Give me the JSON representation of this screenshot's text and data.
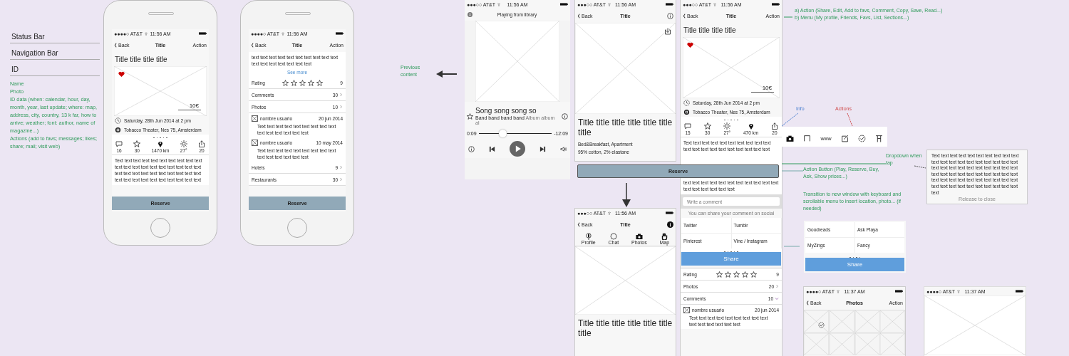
{
  "legend": {
    "rows": [
      "Status Bar",
      "Navigation Bar",
      "ID"
    ],
    "notes": [
      "Name",
      "Photo",
      "ID data (when: calendar, hour, day, month, year, last update; where: map, address, city, country, 13 k far, how to arrive; weather; font: author, name of magazine...)",
      "Actions (add to favs; messages; likes; share; mail; visit web)"
    ]
  },
  "screens": [
    {
      "kind": "phone",
      "status": {
        "carrier": "●●●●○ AT&T",
        "time": "11:56 AM"
      },
      "nav": {
        "back": "Back",
        "title": "Title",
        "right": {
          "kind": "text",
          "label": "Action"
        }
      },
      "overlay_button": {
        "label": "Reserve"
      },
      "blocks": [
        {
          "kind": "title",
          "text": "Title title title title"
        },
        {
          "kind": "photo",
          "favorite": true,
          "price": "10€"
        },
        {
          "kind": "date_info",
          "text": "Saturday, 28th Jun 2014 at 2 pm"
        },
        {
          "kind": "place_info",
          "text": "Tobacco Theater, Nes 75, Amsterdam"
        },
        {
          "kind": "dots"
        },
        {
          "kind": "stats",
          "items": [
            {
              "kind": "comment",
              "value": "16"
            },
            {
              "kind": "star",
              "value": "30"
            },
            {
              "kind": "pin",
              "value": "1470 km"
            },
            {
              "kind": "sun",
              "value": "27°"
            },
            {
              "kind": "share",
              "value": "20"
            }
          ]
        },
        {
          "kind": "text",
          "text": "Text text text text text text text text text text text text text text text text text text text text text text text text text text text text text text text text text text text text text text text text"
        }
      ]
    },
    {
      "kind": "phone",
      "status": {
        "carrier": "●●●●○ AT&T",
        "time": "11:56 AM"
      },
      "nav": {
        "back": "Back",
        "title": "Title",
        "right": {
          "kind": "text",
          "label": "Action"
        }
      },
      "overlay_button": {
        "label": "Reserve"
      },
      "blocks": [
        {
          "kind": "text",
          "text": "text text text text text text text text text text text text text text text text text"
        },
        {
          "kind": "link",
          "text": "See more"
        },
        {
          "kind": "rating",
          "label": "Rating",
          "stars": 0,
          "value": "9"
        },
        {
          "kind": "row",
          "label": "Comments",
          "value": "30",
          "expanded": false
        },
        {
          "kind": "row",
          "label": "Photos",
          "value": "10",
          "expanded": false
        },
        {
          "kind": "comment",
          "user": "nombre usuario",
          "date": "20 jun 2014",
          "text": "Text text text text text text text text text text text text text text text"
        },
        {
          "kind": "comment",
          "user": "nombre usuario",
          "date": "10 may 2014",
          "text": "Text text text text text text text text text text text text text text text"
        },
        {
          "kind": "row",
          "label": "Hotels",
          "value": "9",
          "expanded": false
        },
        {
          "kind": "row",
          "label": "Restaurants",
          "value": "30",
          "expanded": false
        }
      ]
    },
    {
      "kind": "player",
      "status": {
        "carrier": "●●●○○ AT&T",
        "time": "11:56 AM"
      },
      "blocks": [
        {
          "kind": "player_header",
          "text": "Playing from library"
        },
        {
          "kind": "artwork"
        },
        {
          "kind": "song",
          "title": "Song song song so",
          "artist": "Band band band band",
          "album": "Album album al"
        },
        {
          "kind": "progress",
          "level": 0.33,
          "start": "0:09",
          "end": "-12:09"
        },
        {
          "kind": "controls"
        }
      ]
    },
    {
      "kind": "detail",
      "status": {
        "carrier": "●●●○○ AT&T",
        "time": "11:56 AM"
      },
      "nav": {
        "back": "Back",
        "title": "Title",
        "right": {
          "kind": "info"
        }
      },
      "blocks": [
        {
          "kind": "hero",
          "download": true
        },
        {
          "kind": "big_title",
          "text": "Title title title title title title title"
        },
        {
          "kind": "caption",
          "text": "Bed&Breakfast, Apartment"
        },
        {
          "kind": "caption",
          "text": "95% cotton, 2% elastane"
        }
      ]
    },
    {
      "kind": "detail",
      "status": {
        "carrier": "●●●○○ AT&T",
        "time": "11:56 AM"
      },
      "nav": {
        "back": "Back",
        "title": "Title",
        "right": {
          "kind": "info_filled"
        }
      },
      "blocks": [
        {
          "kind": "tabbar",
          "items": [
            {
              "kind": "mic",
              "label": "Profile"
            },
            {
              "kind": "circle",
              "label": "Chat"
            },
            {
              "kind": "camera",
              "label": "Photos"
            },
            {
              "kind": "hand",
              "label": "Map"
            }
          ]
        },
        {
          "kind": "hero",
          "download": false
        },
        {
          "kind": "big_title",
          "text": "Title title title title title title title"
        }
      ]
    },
    {
      "kind": "detail",
      "status": {
        "carrier": "●●●○○ AT&T",
        "time": "11:56 AM"
      },
      "nav": {
        "back": "Back",
        "title": "Title",
        "right": {
          "kind": "text",
          "label": "Action"
        }
      },
      "blocks": [
        {
          "kind": "title",
          "text": "Title title title title"
        },
        {
          "kind": "photo",
          "favorite": true,
          "price": "10€"
        },
        {
          "kind": "date_info",
          "text": "Saturday, 28th Jun 2014 at 2 pm"
        },
        {
          "kind": "place_info",
          "text": "Tobacco Theater, Nes 75, Amsterdam"
        },
        {
          "kind": "dots"
        },
        {
          "kind": "stats",
          "items": [
            {
              "kind": "comment",
              "value": "15"
            },
            {
              "kind": "star",
              "value": "30"
            },
            {
              "kind": "sun",
              "value": "27°"
            },
            {
              "kind": "pin",
              "value": "470 km"
            },
            {
              "kind": "share",
              "value": "20"
            }
          ]
        },
        {
          "kind": "text",
          "text": "Text text text text text text text text text text text text text text text text text text text text"
        },
        {
          "kind": "text",
          "text": "text text text text text text text text text text text text text text text text text"
        },
        {
          "kind": "field",
          "placeholder": "Write a comment"
        },
        {
          "kind": "note",
          "text": "You can share your comment on social"
        },
        {
          "kind": "share_grid",
          "items": [
            "Twitter",
            "Tumblr",
            "Pinterest",
            "Vine / Instagram"
          ]
        },
        {
          "kind": "dots"
        },
        {
          "kind": "button",
          "label": "Share"
        },
        {
          "kind": "rating",
          "label": "Rating",
          "stars": 0,
          "value": "9"
        },
        {
          "kind": "row",
          "label": "Photos",
          "value": "20",
          "expanded": false
        },
        {
          "kind": "row",
          "label": "Comments",
          "value": "10",
          "expanded": true
        },
        {
          "kind": "comment",
          "user": "nombre usuario",
          "date": "20 jun 2014",
          "text": "Text text text text text text text text text text text text text text text"
        }
      ]
    },
    {
      "kind": "detail",
      "status": {
        "carrier": "●●●●○ AT&T",
        "time": "11:37 AM"
      },
      "nav": {
        "back": "Back",
        "title": "Photos",
        "right": {
          "kind": "text",
          "label": "Action"
        }
      },
      "blocks": [
        {
          "kind": "photo_grid"
        }
      ]
    },
    {
      "kind": "viewer",
      "status": {
        "carrier": "●●●●○ AT&T",
        "time": "11:37 AM"
      },
      "blocks": [
        {
          "kind": "hero",
          "download": false
        }
      ]
    }
  ],
  "reserve_bar": {
    "label": "Reserve"
  },
  "annotations": [
    {
      "kind": "note",
      "text": "Previous content"
    },
    {
      "kind": "note",
      "text": "a) Action (Share, Edit, Add to favs, Comment, Copy, Save, Read...)"
    },
    {
      "kind": "note",
      "text": "b) Menu (My profile, Friends, Favs, List, Sections...)"
    },
    {
      "kind": "info",
      "text": "Info"
    },
    {
      "kind": "actions",
      "text": "Actions"
    },
    {
      "kind": "note",
      "text": "Dropdown when tap"
    },
    {
      "kind": "note",
      "text": "Action Button (Play, Reserve, Buy, Ask, Show prices...)"
    },
    {
      "kind": "note",
      "text": "Transition to new window with keyboard and scrollable menu to insert location, photo... (if needed)"
    }
  ],
  "toolbar": {
    "items": [
      {
        "kind": "camera"
      },
      {
        "kind": "bookmark"
      },
      {
        "kind": "text",
        "label": "www"
      },
      {
        "kind": "edit"
      },
      {
        "kind": "check"
      },
      {
        "kind": "stand"
      }
    ]
  },
  "dropdown_card": {
    "text": "Text text text text text text text text text text text text text text text text text text text text text text text text text text text text text text text text text text text text text text text text text text text text text text text text text text text text text text text text text text text text text",
    "hint": "Release to close"
  },
  "share_card": {
    "items": [
      "Goodreads",
      "Ask Playa",
      "MyZings",
      "Fancy"
    ],
    "button": "Share"
  }
}
